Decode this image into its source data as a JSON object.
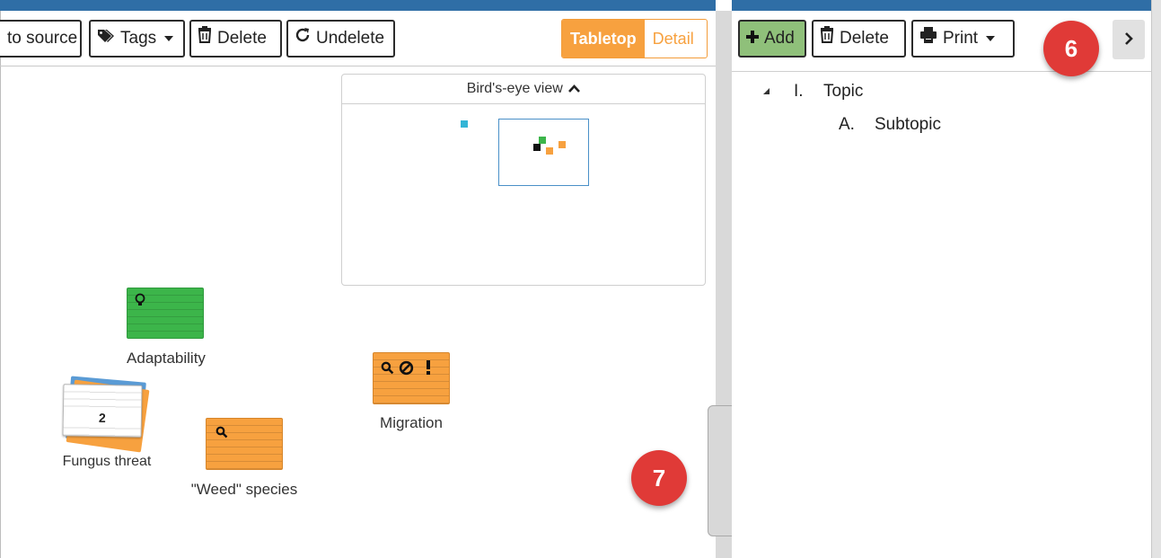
{
  "left_toolbar": {
    "to_source_label": "to source",
    "tags_label": "Tags",
    "delete_label": "Delete",
    "undelete_label": "Undelete",
    "view_toggle": {
      "active": "Tabletop",
      "inactive": "Detail"
    }
  },
  "birds_eye": {
    "title": "Bird's-eye view"
  },
  "cards": {
    "adaptability": "Adaptability",
    "fungus_threat": "Fungus threat",
    "fungus_stack_count": "2",
    "weed_species": "\"Weed\" species",
    "migration": "Migration"
  },
  "right_toolbar": {
    "add_label": "Add",
    "delete_label": "Delete",
    "print_label": "Print"
  },
  "outline": {
    "topic_marker": "I.",
    "topic_label": "Topic",
    "subtopic_marker": "A.",
    "subtopic_label": "Subtopic"
  },
  "callouts": {
    "six": "6",
    "seven": "7"
  },
  "colors": {
    "accent_orange": "#f7a13f",
    "card_green": "#3cb54a",
    "card_blue": "#5a9bd5",
    "add_green": "#8fc07a",
    "callout_red": "#e03a37"
  }
}
